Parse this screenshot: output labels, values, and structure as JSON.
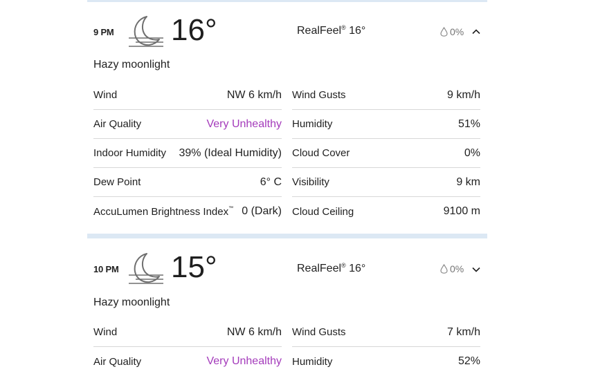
{
  "colors": {
    "separator": "#dce8f4",
    "air_quality_purple": "#a43bbb"
  },
  "hours": [
    {
      "time": "9 PM",
      "icon": "hazy-moon-icon",
      "temp": "16°",
      "realfeel_label": "RealFeel",
      "realfeel_mark": "®",
      "realfeel_value": " 16°",
      "precip": "0%",
      "expanded": true,
      "phrase": "Hazy moonlight",
      "left": [
        {
          "label": "Wind",
          "value": "NW 6 km/h"
        },
        {
          "label": "Air Quality",
          "value": "Very Unhealthy"
        },
        {
          "label": "Indoor Humidity",
          "value": "39% (Ideal Humidity)"
        },
        {
          "label": "Dew Point",
          "value": "6° C"
        },
        {
          "label": "AccuLumen Brightness Index",
          "mark": "™",
          "value": "0 (Dark)"
        }
      ],
      "right": [
        {
          "label": "Wind Gusts",
          "value": "9 km/h"
        },
        {
          "label": "Humidity",
          "value": "51%"
        },
        {
          "label": "Cloud Cover",
          "value": "0%"
        },
        {
          "label": "Visibility",
          "value": "9 km"
        },
        {
          "label": "Cloud Ceiling",
          "value": "9100 m"
        }
      ]
    },
    {
      "time": "10 PM",
      "icon": "hazy-moon-icon",
      "temp": "15°",
      "realfeel_label": "RealFeel",
      "realfeel_mark": "®",
      "realfeel_value": " 16°",
      "precip": "0%",
      "expanded": false,
      "phrase": "Hazy moonlight",
      "left": [
        {
          "label": "Wind",
          "value": "NW 6 km/h"
        },
        {
          "label": "Air Quality",
          "value": "Very Unhealthy"
        }
      ],
      "right": [
        {
          "label": "Wind Gusts",
          "value": "7 km/h"
        },
        {
          "label": "Humidity",
          "value": "52%"
        }
      ]
    }
  ]
}
